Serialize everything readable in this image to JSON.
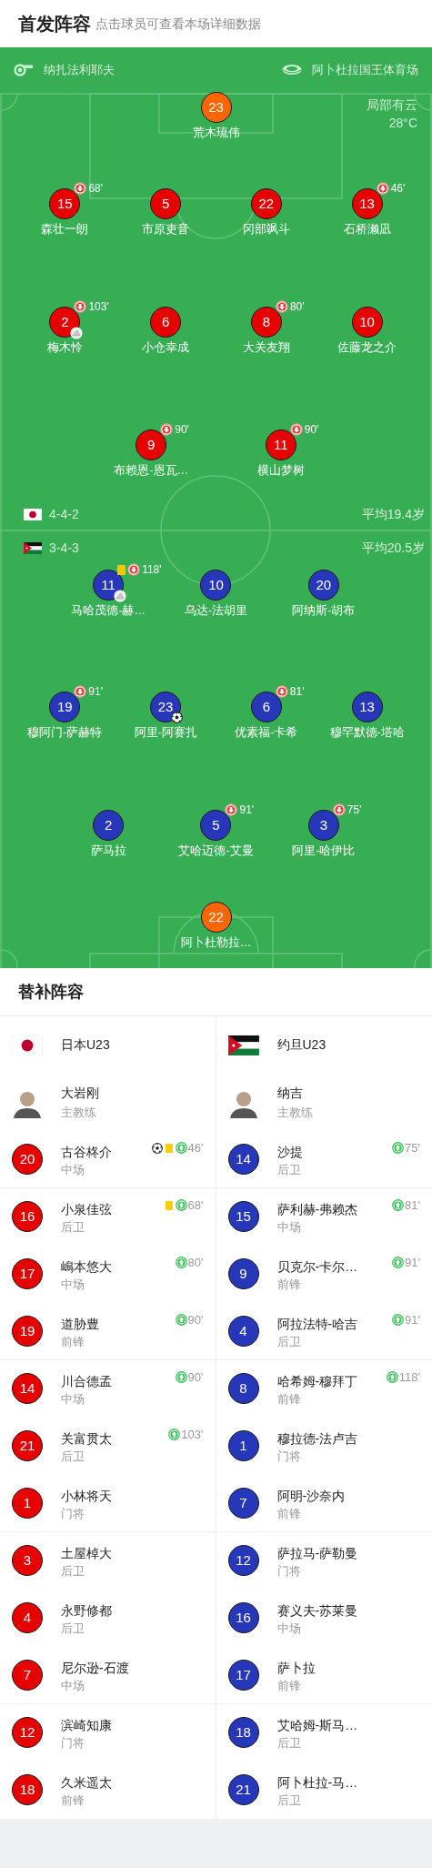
{
  "header": {
    "title": "首发阵容",
    "subtitle": "点击球员可查看本场详细数据"
  },
  "pitch": {
    "referee": "纳扎法利耶夫",
    "stadium": "阿卜杜拉国王体育场",
    "weather": "局部有云",
    "temperature": "28°C",
    "teams": [
      {
        "formation": "4-4-2",
        "avg_age": "平均19.4岁",
        "lines": [
          [
            {
              "number": "23",
              "name": "荒木琉伟",
              "color": "#ff6600"
            }
          ],
          [
            {
              "number": "15",
              "name": "森壮一朗",
              "color": "#e60000",
              "events": [
                {
                  "kind": "sub_out",
                  "minute": "68'"
                }
              ]
            },
            {
              "number": "5",
              "name": "市原吏音",
              "color": "#e60000"
            },
            {
              "number": "22",
              "name": "冈部飒斗",
              "color": "#e60000"
            },
            {
              "number": "13",
              "name": "石桥濑凪",
              "color": "#e60000",
              "events": [
                {
                  "kind": "sub_out",
                  "minute": "46'"
                }
              ]
            }
          ],
          [
            {
              "number": "2",
              "name": "梅木怜",
              "color": "#e60000",
              "events": [
                {
                  "kind": "sub_out",
                  "minute": "103'"
                },
                {
                  "kind": "assist"
                }
              ]
            },
            {
              "number": "6",
              "name": "小仓幸成",
              "color": "#e60000"
            },
            {
              "number": "8",
              "name": "大关友翔",
              "color": "#e60000",
              "events": [
                {
                  "kind": "sub_out",
                  "minute": "80'"
                }
              ]
            },
            {
              "number": "10",
              "name": "佐藤龙之介",
              "color": "#e60000"
            }
          ],
          [
            {
              "number": "9",
              "name": "布赖恩-恩瓦…",
              "color": "#e60000",
              "events": [
                {
                  "kind": "sub_out",
                  "minute": "90'"
                }
              ]
            },
            {
              "number": "11",
              "name": "横山梦树",
              "color": "#e60000",
              "events": [
                {
                  "kind": "sub_out",
                  "minute": "90'"
                }
              ]
            }
          ]
        ]
      },
      {
        "formation": "3-4-3",
        "avg_age": "平均20.5岁",
        "lines": [
          [
            {
              "number": "11",
              "name": "马哈茂德-赫…",
              "color": "#2637b9",
              "events": [
                {
                  "kind": "yellow"
                },
                {
                  "kind": "sub_out",
                  "minute": "118'"
                },
                {
                  "kind": "assist"
                }
              ]
            },
            {
              "number": "10",
              "name": "乌达-法胡里",
              "color": "#2637b9"
            },
            {
              "number": "20",
              "name": "阿纳斯-胡布",
              "color": "#2637b9"
            }
          ],
          [
            {
              "number": "19",
              "name": "穆阿门-萨赫特",
              "color": "#2637b9",
              "events": [
                {
                  "kind": "sub_out",
                  "minute": "91'"
                }
              ]
            },
            {
              "number": "23",
              "name": "阿里-阿赛扎",
              "color": "#2637b9",
              "events": [
                {
                  "kind": "goal"
                }
              ]
            },
            {
              "number": "6",
              "name": "优素福-卡希",
              "color": "#2637b9",
              "events": [
                {
                  "kind": "sub_out",
                  "minute": "81'"
                }
              ]
            },
            {
              "number": "13",
              "name": "穆罕默德-塔哈",
              "color": "#2637b9"
            }
          ],
          [
            {
              "number": "2",
              "name": "萨马拉",
              "color": "#2637b9"
            },
            {
              "number": "5",
              "name": "艾哈迈德-艾曼",
              "color": "#2637b9",
              "events": [
                {
                  "kind": "sub_out",
                  "minute": "91'"
                }
              ]
            },
            {
              "number": "3",
              "name": "阿里-哈伊比",
              "color": "#2637b9",
              "events": [
                {
                  "kind": "sub_out",
                  "minute": "75'"
                }
              ]
            }
          ],
          [
            {
              "number": "22",
              "name": "阿卜杜勒拉…",
              "color": "#ff6600"
            }
          ]
        ]
      }
    ]
  },
  "subs": {
    "title": "替补阵容",
    "teams": [
      {
        "name": "日本U23",
        "color": "#e60000",
        "coach": {
          "name": "大岩刚",
          "role": "主教练"
        },
        "players": [
          {
            "number": "20",
            "name": "古谷柊介",
            "position": "中场",
            "events": [
              {
                "kind": "goal"
              },
              {
                "kind": "yellow"
              },
              {
                "kind": "sub_in",
                "minute": "46'"
              }
            ]
          },
          {
            "number": "16",
            "name": "小泉佳弦",
            "position": "后卫",
            "events": [
              {
                "kind": "yellow"
              },
              {
                "kind": "sub_in",
                "minute": "68'"
              }
            ]
          },
          {
            "number": "17",
            "name": "嶋本悠大",
            "position": "中场",
            "events": [
              {
                "kind": "sub_in",
                "minute": "80'"
              }
            ]
          },
          {
            "number": "19",
            "name": "道胁豊",
            "position": "前锋",
            "events": [
              {
                "kind": "sub_in",
                "minute": "90'"
              }
            ]
          },
          {
            "number": "14",
            "name": "川合德孟",
            "position": "中场",
            "events": [
              {
                "kind": "sub_in",
                "minute": "90'"
              }
            ]
          },
          {
            "number": "21",
            "name": "关富贯太",
            "position": "后卫",
            "events": [
              {
                "kind": "sub_in",
                "minute": "103'"
              }
            ]
          },
          {
            "number": "1",
            "name": "小林将天",
            "position": "门将"
          },
          {
            "number": "3",
            "name": "土屋棹大",
            "position": "后卫"
          },
          {
            "number": "4",
            "name": "永野修都",
            "position": "后卫"
          },
          {
            "number": "7",
            "name": "尼尔逊-石渡",
            "position": "中场"
          },
          {
            "number": "12",
            "name": "滨崎知康",
            "position": "门将"
          },
          {
            "number": "18",
            "name": "久米遥太",
            "position": "前锋"
          }
        ]
      },
      {
        "name": "约旦U23",
        "color": "#2637b9",
        "coach": {
          "name": "纳吉",
          "role": "主教练"
        },
        "players": [
          {
            "number": "14",
            "name": "沙提",
            "position": "后卫",
            "events": [
              {
                "kind": "sub_in",
                "minute": "75'"
              }
            ]
          },
          {
            "number": "15",
            "name": "萨利赫-弗赖杰",
            "position": "中场",
            "events": [
              {
                "kind": "sub_in",
                "minute": "81'"
              }
            ]
          },
          {
            "number": "9",
            "name": "贝克尔-卡尔…",
            "position": "前锋",
            "events": [
              {
                "kind": "sub_in",
                "minute": "91'"
              }
            ]
          },
          {
            "number": "4",
            "name": "阿拉法特-哈吉",
            "position": "后卫",
            "events": [
              {
                "kind": "sub_in",
                "minute": "91'"
              }
            ]
          },
          {
            "number": "8",
            "name": "哈希姆-穆拜丁",
            "position": "前锋",
            "events": [
              {
                "kind": "sub_in",
                "minute": "118'"
              }
            ]
          },
          {
            "number": "1",
            "name": "穆拉德-法卢吉",
            "position": "门将"
          },
          {
            "number": "7",
            "name": "阿明-沙奈内",
            "position": "前锋"
          },
          {
            "number": "12",
            "name": "萨拉马-萨勒曼",
            "position": "门将"
          },
          {
            "number": "16",
            "name": "赛义夫-苏莱曼",
            "position": "中场"
          },
          {
            "number": "17",
            "name": "萨卜拉",
            "position": "前锋"
          },
          {
            "number": "18",
            "name": "艾哈姆-斯马…",
            "position": "后卫"
          },
          {
            "number": "21",
            "name": "阿卜杜拉-马…",
            "position": "后卫"
          }
        ]
      }
    ]
  }
}
